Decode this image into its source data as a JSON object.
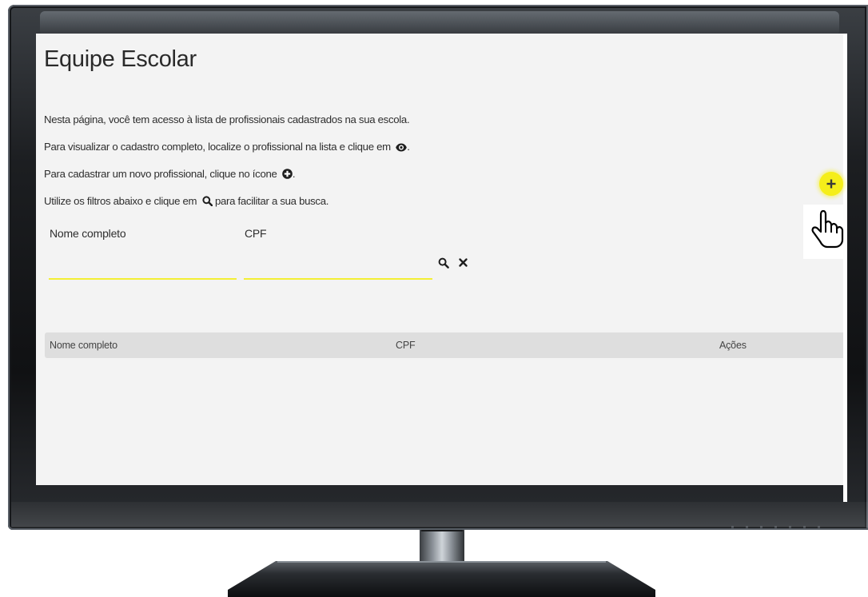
{
  "page": {
    "title": "Equipe Escolar",
    "intro": [
      "Nesta página, você tem acesso à lista de profissionais cadastrados na sua escola.",
      "Para visualizar o cadastro completo, localize o profissional na lista e clique em",
      "Para cadastrar um novo profissional, clique no ícone",
      "Utilize os filtros abaixo e clique em"
    ],
    "intro_suffix": [
      "",
      ".",
      ".",
      "para facilitar a sua busca."
    ],
    "intro_icons": [
      "eye-icon",
      "plus-circle-icon",
      "search-icon"
    ]
  },
  "filters": {
    "name_label": "Nome completo",
    "name_value": "",
    "cpf_label": "CPF",
    "cpf_value": "",
    "search_icon": "search-icon",
    "clear_icon": "close-icon"
  },
  "table": {
    "columns": [
      "Nome completo",
      "CPF",
      "Ações"
    ],
    "rows": []
  },
  "add_button": {
    "icon": "plus-icon",
    "color": "#f5ee1a"
  },
  "cursor": {
    "icon": "hand-pointer-icon"
  },
  "colors": {
    "accent": "#f3ef34",
    "screen_bg": "#f3f3f3",
    "table_header_bg": "#dedede"
  }
}
